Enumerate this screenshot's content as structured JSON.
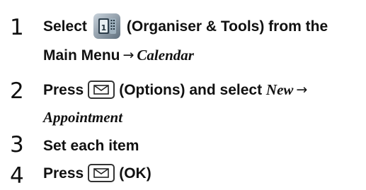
{
  "steps": [
    {
      "number": "1",
      "line1_a": "Select",
      "icon": "organiser-tools-icon",
      "line1_b": "(Organiser & Tools) from the",
      "line2_a": "Main Menu",
      "arrow": "→",
      "line2_b": "Calendar"
    },
    {
      "number": "2",
      "line1_a": "Press",
      "key": "mail-key-icon",
      "line1_b": "(Options) and select",
      "line1_c": "New",
      "arrow": "→",
      "line2_a": "Appointment"
    },
    {
      "number": "3",
      "text": "Set each item"
    },
    {
      "number": "4",
      "line1_a": "Press",
      "key": "mail-key-icon",
      "line1_b": "(OK)"
    }
  ]
}
